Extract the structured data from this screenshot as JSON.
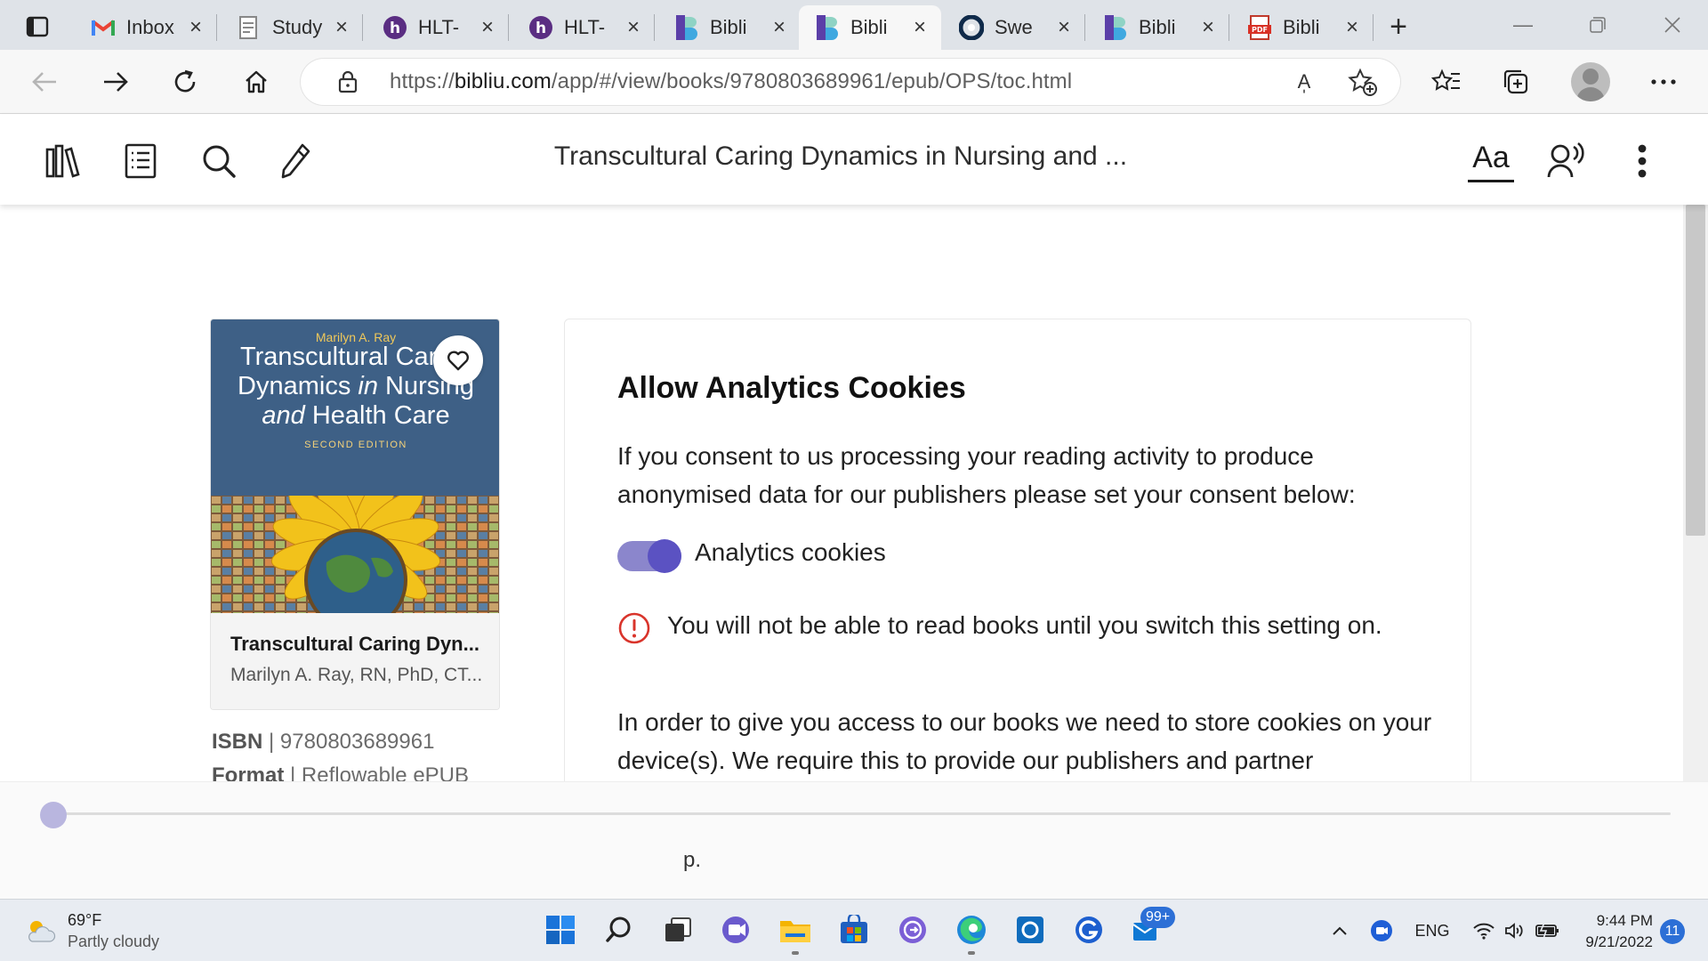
{
  "browser": {
    "tabs": [
      {
        "label": "Inbox",
        "favicon": "gmail-icon",
        "active": false
      },
      {
        "label": "Study",
        "favicon": "document-icon",
        "active": false
      },
      {
        "label": "HLT-",
        "favicon": "hypothesis-icon",
        "active": false
      },
      {
        "label": "HLT-",
        "favicon": "hypothesis-icon",
        "active": false
      },
      {
        "label": "Bibli",
        "favicon": "bibliu-icon",
        "active": false
      },
      {
        "label": "Bibli",
        "favicon": "bibliu-icon",
        "active": true
      },
      {
        "label": "Swe",
        "favicon": "circle-logo-icon",
        "active": false
      },
      {
        "label": "Bibli",
        "favicon": "bibliu-icon",
        "active": false
      },
      {
        "label": "Bibli",
        "favicon": "pdf-icon",
        "active": false
      }
    ],
    "url_prefix": "https://",
    "url_host": "bibliu.com",
    "url_path": "/app/#/view/books/9780803689961/epub/OPS/toc.html",
    "read_aloud_label": "A̩"
  },
  "reader": {
    "title": "Transcultural Caring Dynamics in Nursing and ...",
    "font_button_label": "Aa"
  },
  "book": {
    "cover_author": "Marilyn A. Ray",
    "cover_title_line1": "Transcultural Caring",
    "cover_title_line2a": "Dynamics ",
    "cover_title_line2b": "in",
    "cover_title_line2c": " Nursing",
    "cover_title_line3a": "and",
    "cover_title_line3b": " Health Care",
    "cover_edition": "SECOND EDITION",
    "card_title": "Transcultural Caring Dyn...",
    "card_author": "Marilyn A. Ray, RN, PhD, CT...",
    "isbn_label": "ISBN",
    "isbn_value": "9780803689961",
    "format_label": "Format",
    "format_value": "Reflowable ePUB"
  },
  "cookies": {
    "title": "Allow Analytics Cookies",
    "description": "If you consent to us processing your reading activity to produce anonymised data for our publishers please set your consent below:",
    "toggle_label": "Analytics cookies",
    "toggle_on": true,
    "warning": "You will not be able to read books until you switch this setting on.",
    "more_text": "In order to give you access to our books we need to store cookies on your device(s). We require this to provide our publishers and partner"
  },
  "progress": {
    "page_label": "p.",
    "position": 0
  },
  "taskbar": {
    "weather_temp": "69°F",
    "weather_desc": "Partly cloudy",
    "mail_badge": "99+",
    "language": "ENG",
    "time": "9:44 PM",
    "date": "9/21/2022",
    "notifications": "11"
  },
  "colors": {
    "accent": "#5b52c2",
    "toggle_track": "#8b86cc",
    "warning": "#d9342b",
    "cover_bg": "#3e6086"
  }
}
